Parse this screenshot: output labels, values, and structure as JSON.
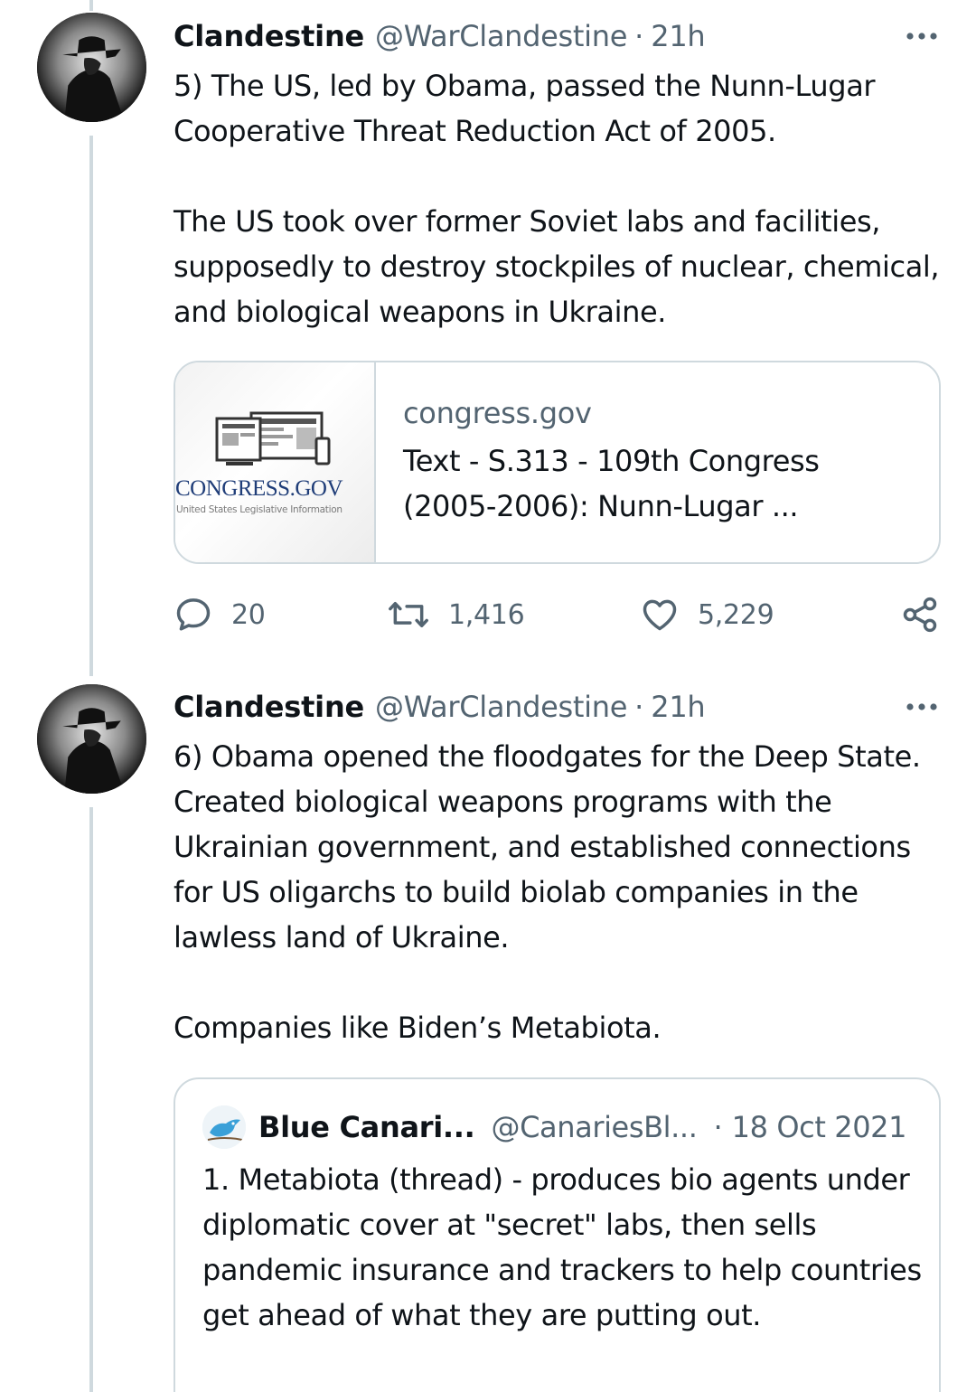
{
  "tweets": [
    {
      "name": "Clandestine",
      "handle": "@WarClandestine",
      "separator": "·",
      "time": "21h",
      "text": "5) The US, led by Obama, passed the Nunn-Lugar Cooperative Threat Reduction Act of 2005.\n\nThe US took over former Soviet labs and facilities, supposedly to destroy stockpiles of nuclear, chemical, and biological weapons in Ukraine.",
      "card": {
        "domain": "congress.gov",
        "title": "Text - S.313 - 109th Congress (2005-2006): Nunn-Lugar ...",
        "logo_text": "CONGRESS.GOV",
        "logo_subtext": "United States Legislative Information"
      },
      "actions": {
        "replies": "20",
        "retweets": "1,416",
        "likes": "5,229"
      }
    },
    {
      "name": "Clandestine",
      "handle": "@WarClandestine",
      "separator": "·",
      "time": "21h",
      "text": "6) Obama opened the floodgates for the Deep State. Created biological weapons programs with the Ukrainian government, and established connections for US oligarchs to build biolab companies in the lawless land of Ukraine.\n\nCompanies like Biden’s Metabiota.",
      "quote": {
        "name": "Blue Canari...",
        "handle": "@CanariesBl...",
        "separator": "·",
        "time": "18 Oct 2021",
        "text": "1. Metabiota (thread) - produces bio agents under diplomatic cover at \"secret\" labs, then sells pandemic insurance and trackers to help countries get ahead of what they are putting out."
      }
    }
  ],
  "colors": {
    "text": "#0f1419",
    "secondary": "#536471",
    "border": "#cfd9de",
    "thread_line": "#cfd9de",
    "congress_blue": "#1f3d78"
  },
  "icons": [
    "more-icon",
    "reply-icon",
    "retweet-icon",
    "like-icon",
    "share-icon"
  ]
}
